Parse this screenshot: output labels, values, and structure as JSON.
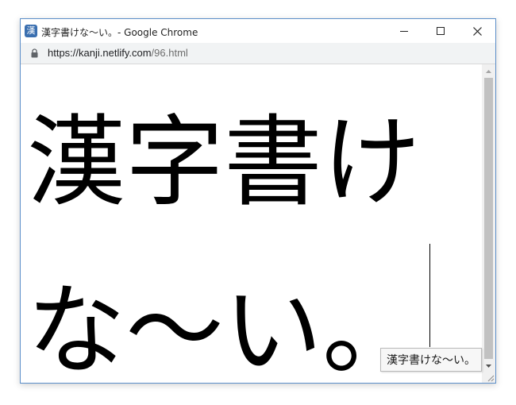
{
  "window": {
    "title": "漢字書けな〜い。- Google Chrome",
    "favicon_glyph": "漢",
    "favicon_color": "#3a6fb0",
    "border_color": "#5c8fc9"
  },
  "addressbar": {
    "url_host": "https://kanji.netlify.com",
    "url_path": "/96.html",
    "lock_icon": "lock-icon"
  },
  "content": {
    "text": "漢字書けな〜い。"
  },
  "tooltip": {
    "text": "漢字書けな〜い。"
  }
}
